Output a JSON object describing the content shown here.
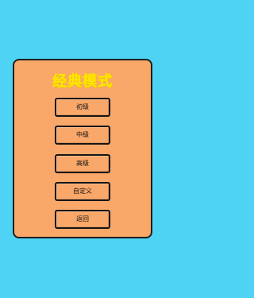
{
  "screen": {
    "title": "经典模式",
    "buttons": [
      "初级",
      "中级",
      "高级",
      "自定义",
      "返回"
    ]
  },
  "colors": {
    "background": "#4fd3f5",
    "panel": "#f9a86a",
    "title": "#ffe600",
    "border": "#1f1f1f"
  }
}
